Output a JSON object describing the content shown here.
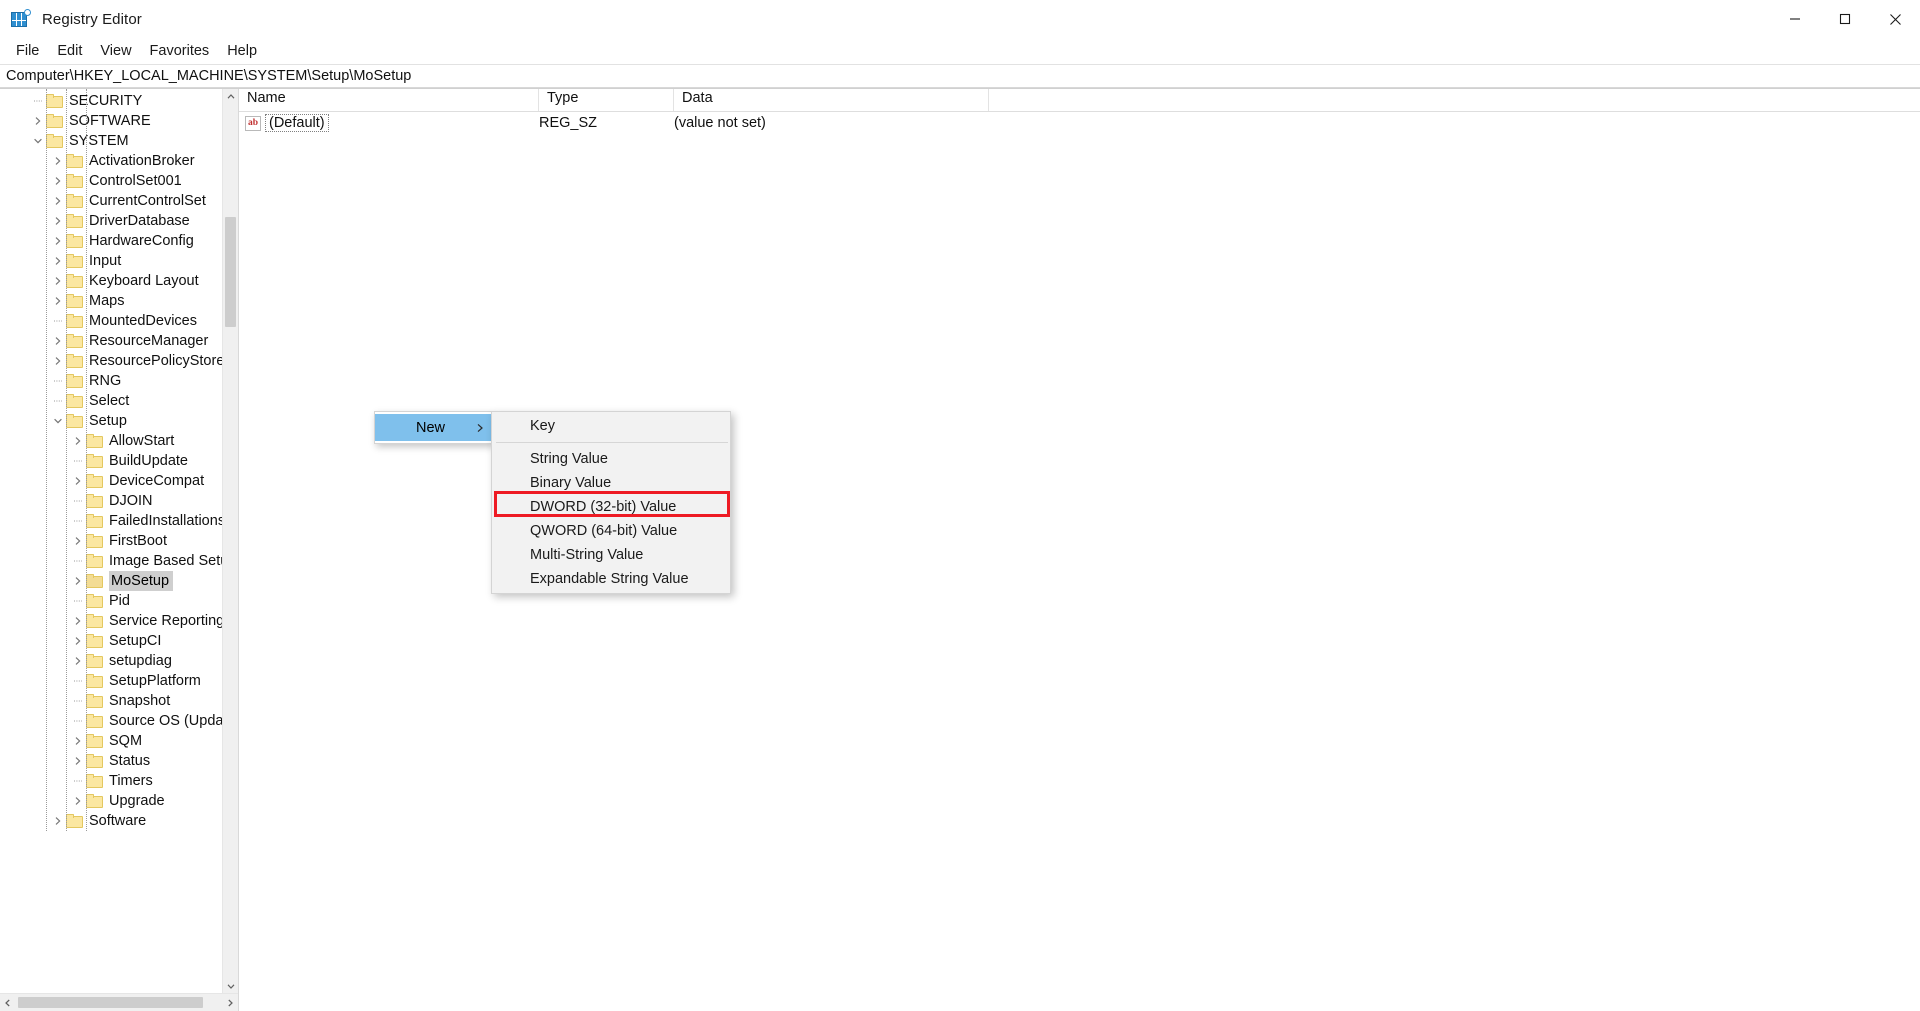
{
  "window": {
    "title": "Registry Editor",
    "icon": "registry-editor-icon",
    "controls": {
      "minimize": "minimize-icon",
      "maximize": "maximize-icon",
      "close": "close-icon"
    }
  },
  "menubar": {
    "items": [
      "File",
      "Edit",
      "View",
      "Favorites",
      "Help"
    ]
  },
  "address": {
    "path": "Computer\\HKEY_LOCAL_MACHINE\\SYSTEM\\Setup\\MoSetup"
  },
  "tree": {
    "nodes": [
      {
        "label": "SECURITY",
        "indent": 1,
        "twist": "none",
        "selected": false
      },
      {
        "label": "SOFTWARE",
        "indent": 1,
        "twist": "collapsed",
        "selected": false
      },
      {
        "label": "SYSTEM",
        "indent": 1,
        "twist": "expanded",
        "selected": false
      },
      {
        "label": "ActivationBroker",
        "indent": 2,
        "twist": "collapsed",
        "selected": false
      },
      {
        "label": "ControlSet001",
        "indent": 2,
        "twist": "collapsed",
        "selected": false
      },
      {
        "label": "CurrentControlSet",
        "indent": 2,
        "twist": "collapsed",
        "selected": false
      },
      {
        "label": "DriverDatabase",
        "indent": 2,
        "twist": "collapsed",
        "selected": false
      },
      {
        "label": "HardwareConfig",
        "indent": 2,
        "twist": "collapsed",
        "selected": false
      },
      {
        "label": "Input",
        "indent": 2,
        "twist": "collapsed",
        "selected": false
      },
      {
        "label": "Keyboard Layout",
        "indent": 2,
        "twist": "collapsed",
        "selected": false
      },
      {
        "label": "Maps",
        "indent": 2,
        "twist": "collapsed",
        "selected": false
      },
      {
        "label": "MountedDevices",
        "indent": 2,
        "twist": "none",
        "selected": false
      },
      {
        "label": "ResourceManager",
        "indent": 2,
        "twist": "collapsed",
        "selected": false
      },
      {
        "label": "ResourcePolicyStore",
        "indent": 2,
        "twist": "collapsed",
        "selected": false
      },
      {
        "label": "RNG",
        "indent": 2,
        "twist": "none",
        "selected": false
      },
      {
        "label": "Select",
        "indent": 2,
        "twist": "none",
        "selected": false
      },
      {
        "label": "Setup",
        "indent": 2,
        "twist": "expanded",
        "selected": false
      },
      {
        "label": "AllowStart",
        "indent": 3,
        "twist": "collapsed",
        "selected": false
      },
      {
        "label": "BuildUpdate",
        "indent": 3,
        "twist": "none",
        "selected": false
      },
      {
        "label": "DeviceCompat",
        "indent": 3,
        "twist": "collapsed",
        "selected": false
      },
      {
        "label": "DJOIN",
        "indent": 3,
        "twist": "none",
        "selected": false
      },
      {
        "label": "FailedInstallations",
        "indent": 3,
        "twist": "none",
        "selected": false
      },
      {
        "label": "FirstBoot",
        "indent": 3,
        "twist": "collapsed",
        "selected": false
      },
      {
        "label": "Image Based Setup",
        "indent": 3,
        "twist": "none",
        "selected": false
      },
      {
        "label": "MoSetup",
        "indent": 3,
        "twist": "collapsed",
        "selected": true
      },
      {
        "label": "Pid",
        "indent": 3,
        "twist": "none",
        "selected": false
      },
      {
        "label": "Service Reporting",
        "indent": 3,
        "twist": "collapsed",
        "selected": false
      },
      {
        "label": "SetupCI",
        "indent": 3,
        "twist": "collapsed",
        "selected": false
      },
      {
        "label": "setupdiag",
        "indent": 3,
        "twist": "collapsed",
        "selected": false
      },
      {
        "label": "SetupPlatform",
        "indent": 3,
        "twist": "none",
        "selected": false
      },
      {
        "label": "Snapshot",
        "indent": 3,
        "twist": "none",
        "selected": false
      },
      {
        "label": "Source OS (Updated)",
        "indent": 3,
        "twist": "none",
        "selected": false
      },
      {
        "label": "SQM",
        "indent": 3,
        "twist": "collapsed",
        "selected": false
      },
      {
        "label": "Status",
        "indent": 3,
        "twist": "collapsed",
        "selected": false
      },
      {
        "label": "Timers",
        "indent": 3,
        "twist": "none",
        "selected": false
      },
      {
        "label": "Upgrade",
        "indent": 3,
        "twist": "collapsed",
        "selected": false
      },
      {
        "label": "Software",
        "indent": 2,
        "twist": "collapsed",
        "selected": false
      }
    ]
  },
  "list": {
    "columns": [
      "Name",
      "Type",
      "Data"
    ],
    "rows": [
      {
        "name": "(Default)",
        "icon": "ab-string-icon",
        "type": "REG_SZ",
        "data": "(value not set)"
      }
    ]
  },
  "context_menu": {
    "parent": {
      "items": [
        {
          "label": "New",
          "highlighted": true,
          "submenu_arrow": "chevron-right-icon"
        }
      ]
    },
    "submenu": {
      "items": [
        {
          "label": "Key",
          "separator_after": true,
          "highlighted": false
        },
        {
          "label": "String Value",
          "separator_after": false,
          "highlighted": false
        },
        {
          "label": "Binary Value",
          "separator_after": false,
          "highlighted": false
        },
        {
          "label": "DWORD (32-bit) Value",
          "separator_after": false,
          "highlighted": true
        },
        {
          "label": "QWORD (64-bit) Value",
          "separator_after": false,
          "highlighted": false
        },
        {
          "label": "Multi-String Value",
          "separator_after": false,
          "highlighted": false
        },
        {
          "label": "Expandable String Value",
          "separator_after": false,
          "highlighted": false
        }
      ]
    }
  },
  "colors": {
    "highlight_blue": "#7fc0ec",
    "annotation_red": "#ee1b24",
    "folder_yellow": "#fbe7a1",
    "selection_grey": "#cfcfcf"
  }
}
